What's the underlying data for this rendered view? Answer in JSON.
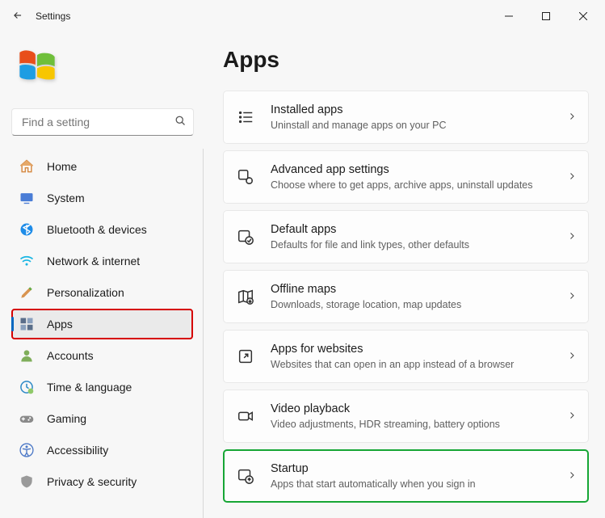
{
  "window": {
    "title": "Settings"
  },
  "search": {
    "placeholder": "Find a setting"
  },
  "sidebar": {
    "items": [
      {
        "label": "Home"
      },
      {
        "label": "System"
      },
      {
        "label": "Bluetooth & devices"
      },
      {
        "label": "Network & internet"
      },
      {
        "label": "Personalization"
      },
      {
        "label": "Apps"
      },
      {
        "label": "Accounts"
      },
      {
        "label": "Time & language"
      },
      {
        "label": "Gaming"
      },
      {
        "label": "Accessibility"
      },
      {
        "label": "Privacy & security"
      }
    ]
  },
  "main": {
    "title": "Apps",
    "cards": [
      {
        "title": "Installed apps",
        "sub": "Uninstall and manage apps on your PC"
      },
      {
        "title": "Advanced app settings",
        "sub": "Choose where to get apps, archive apps, uninstall updates"
      },
      {
        "title": "Default apps",
        "sub": "Defaults for file and link types, other defaults"
      },
      {
        "title": "Offline maps",
        "sub": "Downloads, storage location, map updates"
      },
      {
        "title": "Apps for websites",
        "sub": "Websites that can open in an app instead of a browser"
      },
      {
        "title": "Video playback",
        "sub": "Video adjustments, HDR streaming, battery options"
      },
      {
        "title": "Startup",
        "sub": "Apps that start automatically when you sign in"
      }
    ]
  }
}
